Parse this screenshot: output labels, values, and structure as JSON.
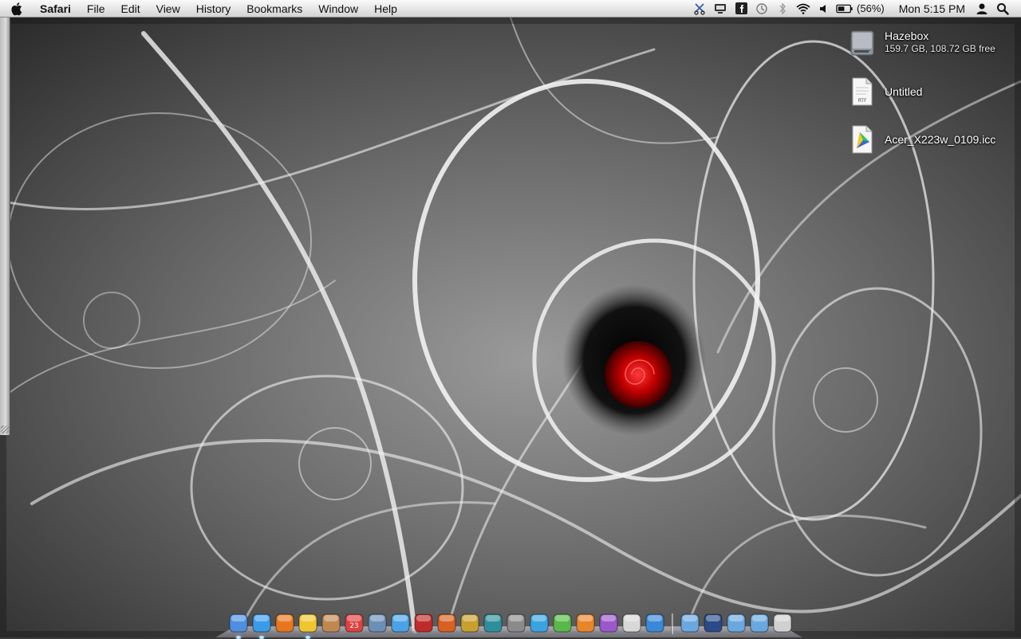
{
  "menubar": {
    "apple_icon": "apple-logo-icon",
    "app_name": "Safari",
    "menus": [
      "File",
      "Edit",
      "View",
      "History",
      "Bookmarks",
      "Window",
      "Help"
    ],
    "status_icons": [
      "scissors-icon",
      "display-icon",
      "facebook-icon",
      "time-machine-icon",
      "bluetooth-icon",
      "wifi-icon",
      "volume-icon",
      "battery-icon"
    ],
    "battery_percent": "(56%)",
    "battery_level": 0.56,
    "clock": "Mon 5:15 PM",
    "user_icon": "user-icon",
    "spotlight_icon": "spotlight-search-icon"
  },
  "desktop": {
    "items": [
      {
        "name": "Hazebox",
        "sublabel": "159.7 GB, 108.72 GB free",
        "icon": "hard-drive-icon"
      },
      {
        "name": "Untitled",
        "sublabel": "",
        "icon": "rtf-document-icon",
        "badge": "RTF"
      },
      {
        "name": "Acer_X223w_0109.icc",
        "sublabel": "",
        "icon": "color-profile-icon"
      }
    ]
  },
  "dock": {
    "apps": [
      {
        "name": "Finder",
        "icon": "finder-icon",
        "running": true,
        "color": "#4d8fe0"
      },
      {
        "name": "Safari",
        "icon": "safari-icon",
        "running": true,
        "color": "#3a9be8"
      },
      {
        "name": "Firefox",
        "icon": "firefox-icon",
        "running": false,
        "color": "#e8761c"
      },
      {
        "name": "Adium",
        "icon": "duck-icon",
        "running": true,
        "color": "#f0c630"
      },
      {
        "name": "Address Book",
        "icon": "address-book-icon",
        "running": false,
        "color": "#c08850"
      },
      {
        "name": "iCal",
        "icon": "calendar-icon",
        "running": false,
        "color": "#e04040",
        "badge": "23"
      },
      {
        "name": "iPhoto",
        "icon": "iphoto-icon",
        "running": false,
        "color": "#6c8fb8"
      },
      {
        "name": "iTunes",
        "icon": "itunes-icon",
        "running": false,
        "color": "#4aa3e8"
      },
      {
        "name": "Front Row",
        "icon": "front-row-icon",
        "running": false,
        "color": "#c02a2a"
      },
      {
        "name": "Photo Booth",
        "icon": "photo-booth-icon",
        "running": false,
        "color": "#d86020"
      },
      {
        "name": "Dashboard",
        "icon": "dashboard-icon",
        "running": false,
        "color": "#c8a030"
      },
      {
        "name": "Time Machine",
        "icon": "time-machine-icon",
        "running": false,
        "color": "#2e8f9c"
      },
      {
        "name": "System Preferences",
        "icon": "system-preferences-icon",
        "running": false,
        "color": "#8a8a8a"
      },
      {
        "name": "Word",
        "icon": "word-icon",
        "running": false,
        "color": "#3aa3e0"
      },
      {
        "name": "Excel",
        "icon": "excel-icon",
        "running": false,
        "color": "#58b848"
      },
      {
        "name": "PowerPoint",
        "icon": "powerpoint-icon",
        "running": false,
        "color": "#e8842a"
      },
      {
        "name": "Entourage",
        "icon": "entourage-icon",
        "running": false,
        "color": "#9a58c8"
      },
      {
        "name": "Preview",
        "icon": "preview-icon",
        "running": false,
        "color": "#d8d8d8"
      },
      {
        "name": "Installer",
        "icon": "installer-icon",
        "running": false,
        "color": "#3a88d8"
      }
    ],
    "stacks": [
      {
        "name": "Applications",
        "icon": "applications-folder-icon",
        "color": "#6aa8e0"
      },
      {
        "name": "Screen Sharing",
        "icon": "screen-icon",
        "color": "#2a4a8a"
      },
      {
        "name": "Documents",
        "icon": "documents-folder-icon",
        "color": "#6aa8e0"
      },
      {
        "name": "Downloads",
        "icon": "downloads-folder-icon",
        "color": "#6aa8e0"
      },
      {
        "name": "Trash",
        "icon": "trash-icon",
        "color": "#d0d0d0"
      }
    ]
  }
}
